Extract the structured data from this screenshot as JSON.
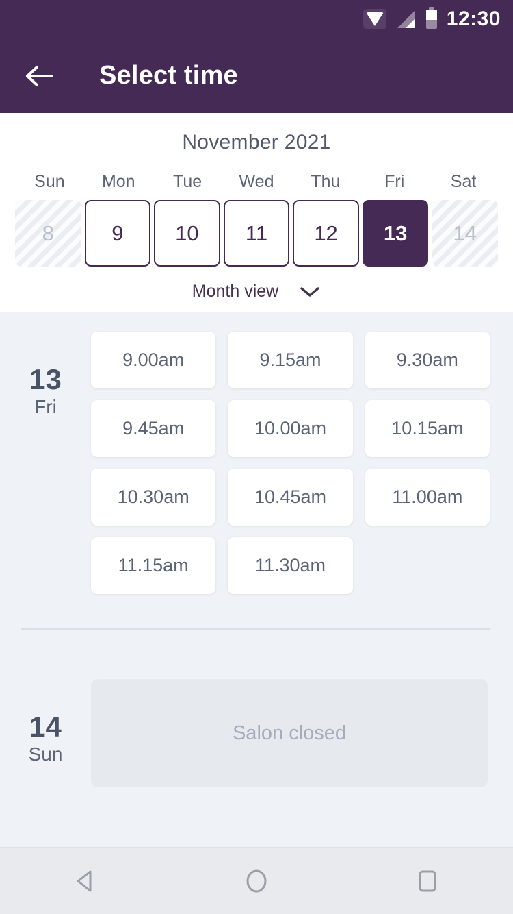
{
  "status_bar": {
    "time": "12:30",
    "icons": [
      "wifi-icon",
      "signal-icon",
      "battery-icon"
    ]
  },
  "app_bar": {
    "back_icon": "arrow-left-icon",
    "title": "Select time"
  },
  "calendar": {
    "month_title": "November 2021",
    "weekdays": [
      "Sun",
      "Mon",
      "Tue",
      "Wed",
      "Thu",
      "Fri",
      "Sat"
    ],
    "dates": [
      {
        "day": "8",
        "state": "disabled"
      },
      {
        "day": "9",
        "state": "available"
      },
      {
        "day": "10",
        "state": "available"
      },
      {
        "day": "11",
        "state": "available"
      },
      {
        "day": "12",
        "state": "available"
      },
      {
        "day": "13",
        "state": "selected"
      },
      {
        "day": "14",
        "state": "disabled"
      }
    ],
    "view_toggle": {
      "label": "Month view",
      "icon": "chevron-down-icon"
    }
  },
  "schedule": {
    "days": [
      {
        "date_number": "13",
        "weekday": "Fri",
        "slots": [
          "9.00am",
          "9.15am",
          "9.30am",
          "9.45am",
          "10.00am",
          "10.15am",
          "10.30am",
          "10.45am",
          "11.00am",
          "11.15am",
          "11.30am"
        ]
      },
      {
        "date_number": "14",
        "weekday": "Sun",
        "closed_message": "Salon closed"
      }
    ]
  },
  "nav_bar": {
    "back": "triangle-back-icon",
    "home": "circle-home-icon",
    "recents": "square-recents-icon"
  },
  "colors": {
    "brand_purple": "#452a56",
    "page_background": "#eff2f6",
    "slot_text": "#5a6377",
    "muted_text": "#a5adbd"
  }
}
